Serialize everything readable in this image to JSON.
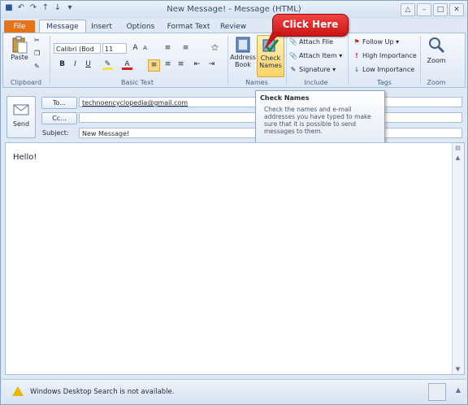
{
  "window": {
    "title": "New Message! - Message (HTML)",
    "quick_access": [
      "save-icon",
      "undo-icon",
      "redo-icon",
      "up-icon",
      "down-icon",
      "customize-icon"
    ],
    "controls": [
      "minimize-icon",
      "maximize-icon",
      "close-icon"
    ]
  },
  "tabs": {
    "file": "File",
    "message": "Message",
    "insert": "Insert",
    "options": "Options",
    "format_text": "Format Text",
    "review": "Review"
  },
  "ribbon": {
    "clipboard": {
      "label": "Clipboard",
      "paste": "Paste"
    },
    "basic_text": {
      "label": "Basic Text",
      "font": "Calibri (Bod",
      "size": "11",
      "bold": "B",
      "italic": "I",
      "underline": "U"
    },
    "names": {
      "label": "Names",
      "address_book_1": "Address",
      "address_book_2": "Book",
      "check_names_1": "Check",
      "check_names_2": "Names"
    },
    "include": {
      "label": "Include",
      "attach_file": "Attach File",
      "attach_item": "Attach Item",
      "signature": "Signature"
    },
    "tags": {
      "label": "Tags",
      "follow_up": "Follow Up",
      "high_importance": "High Importance",
      "low_importance": "Low Importance"
    },
    "zoom": {
      "label": "Zoom",
      "zoom": "Zoom"
    }
  },
  "callout": {
    "text": "Click Here"
  },
  "tooltip": {
    "title": "Check Names",
    "body": "Check the names and e-mail addresses you have typed to make sure that it is possible to send messages to them."
  },
  "compose": {
    "send": "Send",
    "to_button": "To...",
    "cc_button": "Cc...",
    "subject_label": "Subject:",
    "to_value": "technoencyclopedia@gmail.com",
    "cc_value": "",
    "subject_value": "New Message!",
    "body": "Hello!"
  },
  "status": {
    "text": "Windows Desktop Search is not available."
  },
  "colors": {
    "file_tab": "#e67319",
    "callout": "#d71c1c",
    "ribbon": "#dde8f5"
  }
}
